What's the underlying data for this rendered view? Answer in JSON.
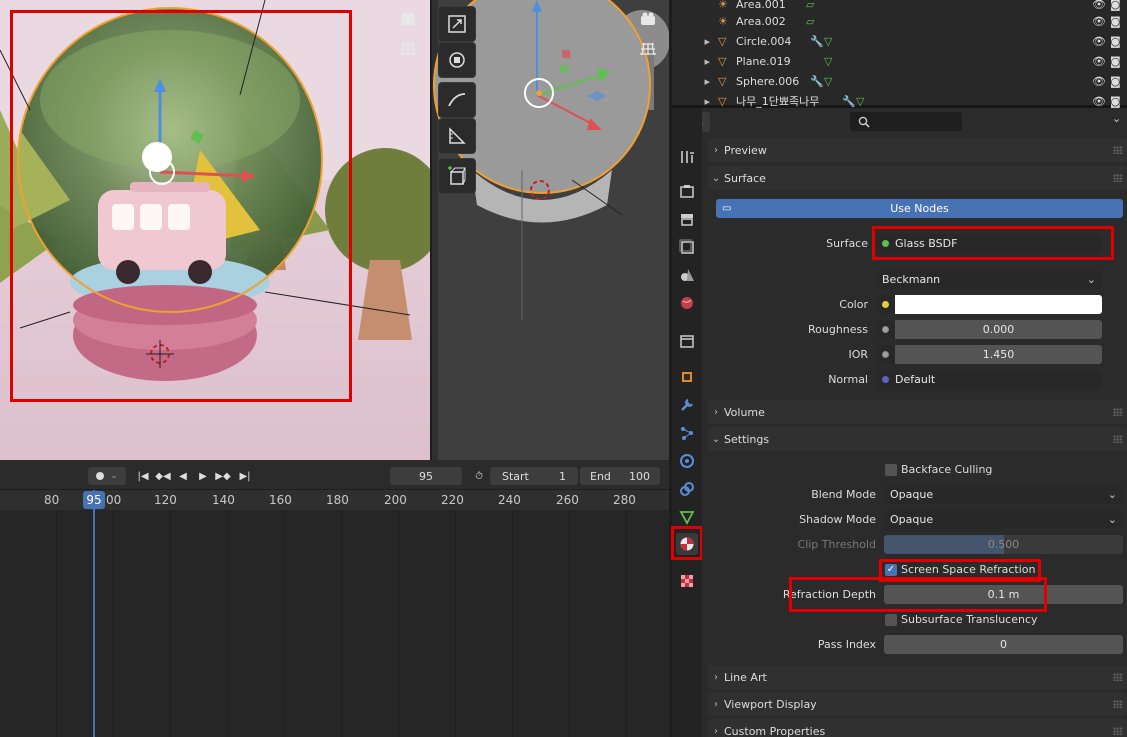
{
  "viewport_left": {
    "camera_icon": "camera-icon",
    "grid_icon": "grid-icon"
  },
  "timeline": {
    "current_frame": "95",
    "start_label": "Start",
    "start_value": "1",
    "end_label": "End",
    "end_value": "100",
    "ruler_ticks": [
      "80",
      "95",
      "00",
      "120",
      "140",
      "160",
      "180",
      "200",
      "220",
      "240",
      "260",
      "280"
    ]
  },
  "outliner": {
    "items": [
      {
        "name": "Area.001"
      },
      {
        "name": "Area.002"
      },
      {
        "name": "Circle.004"
      },
      {
        "name": "Plane.019"
      },
      {
        "name": "Sphere.006"
      },
      {
        "name": "나무_1단뾰족나무"
      }
    ]
  },
  "properties": {
    "panels": {
      "preview": "Preview",
      "surface": "Surface",
      "volume": "Volume",
      "settings": "Settings",
      "line_art": "Line Art",
      "viewport_display": "Viewport Display",
      "custom_properties": "Custom Properties"
    },
    "surface": {
      "use_nodes": "Use Nodes",
      "surface_label": "Surface",
      "surface_value": "Glass BSDF",
      "distribution": "Beckmann",
      "color_label": "Color",
      "color_value": "#ffffff",
      "roughness_label": "Roughness",
      "roughness_value": "0.000",
      "ior_label": "IOR",
      "ior_value": "1.450",
      "normal_label": "Normal",
      "normal_value": "Default"
    },
    "settings": {
      "backface_culling": "Backface Culling",
      "blend_mode_label": "Blend Mode",
      "blend_mode_value": "Opaque",
      "shadow_mode_label": "Shadow Mode",
      "shadow_mode_value": "Opaque",
      "clip_threshold_label": "Clip Threshold",
      "clip_threshold_value": "0.500",
      "ssr_label": "Screen Space Refraction",
      "refraction_depth_label": "Refraction Depth",
      "refraction_depth_value": "0.1 m",
      "subsurface_label": "Subsurface Translucency",
      "pass_index_label": "Pass Index",
      "pass_index_value": "0"
    }
  },
  "colors": {
    "highlight": "#e00000",
    "accent": "#4772b3",
    "selection_orange": "#f0a030"
  }
}
